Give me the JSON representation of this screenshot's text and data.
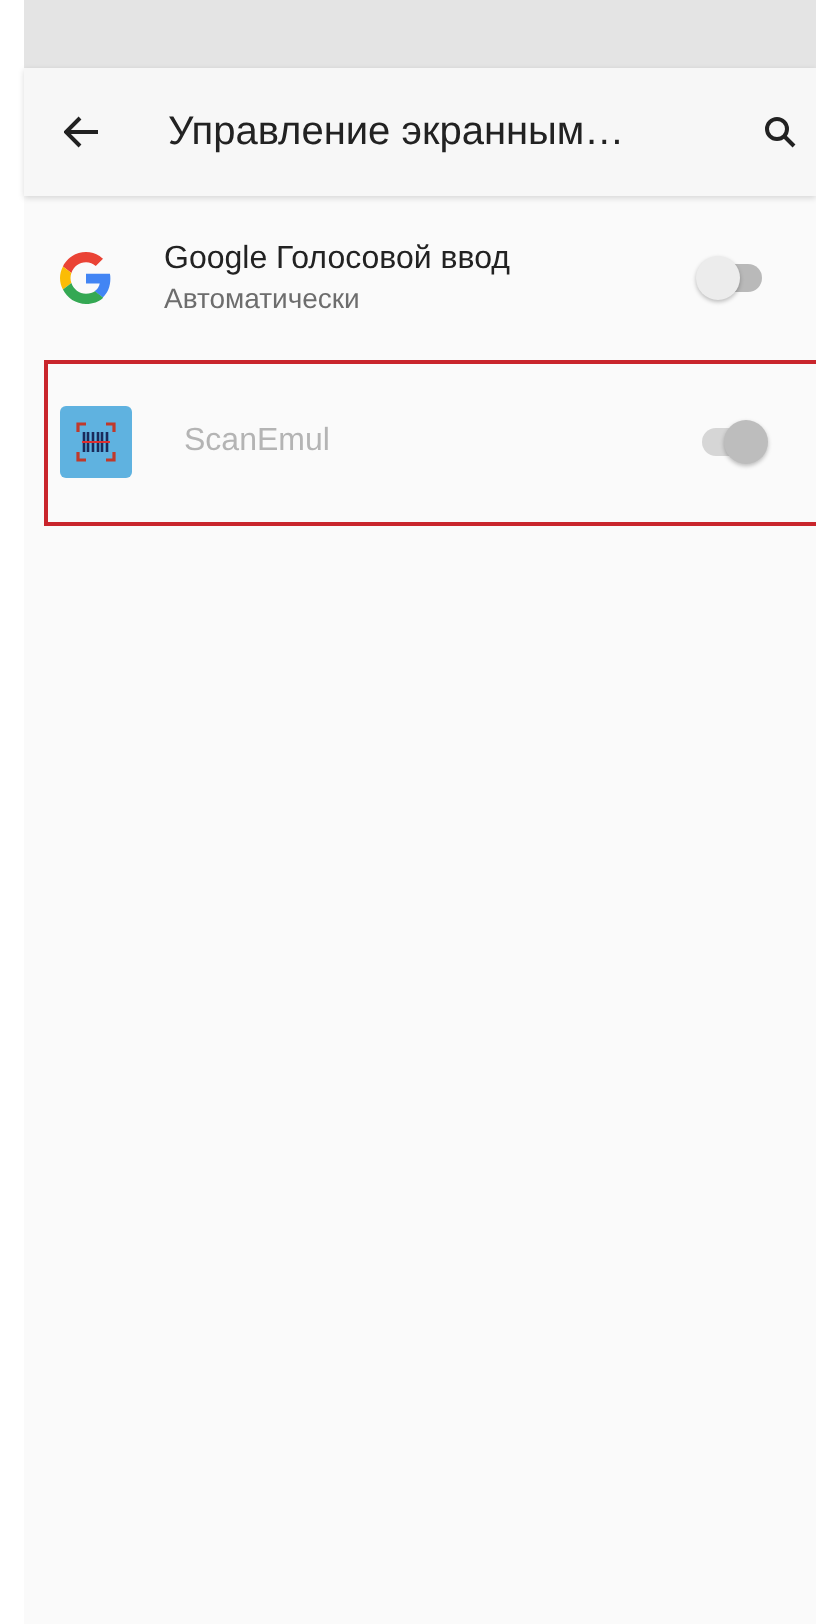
{
  "toolbar": {
    "title": "Управление экранным…"
  },
  "items": [
    {
      "kind": "google",
      "title": "Google Голосовой ввод",
      "subtitle": "Автоматически",
      "on": false,
      "disabled": false,
      "highlighted": false
    },
    {
      "kind": "scanner",
      "title": "ScanEmul",
      "on": true,
      "disabled": true,
      "highlighted": true
    }
  ]
}
